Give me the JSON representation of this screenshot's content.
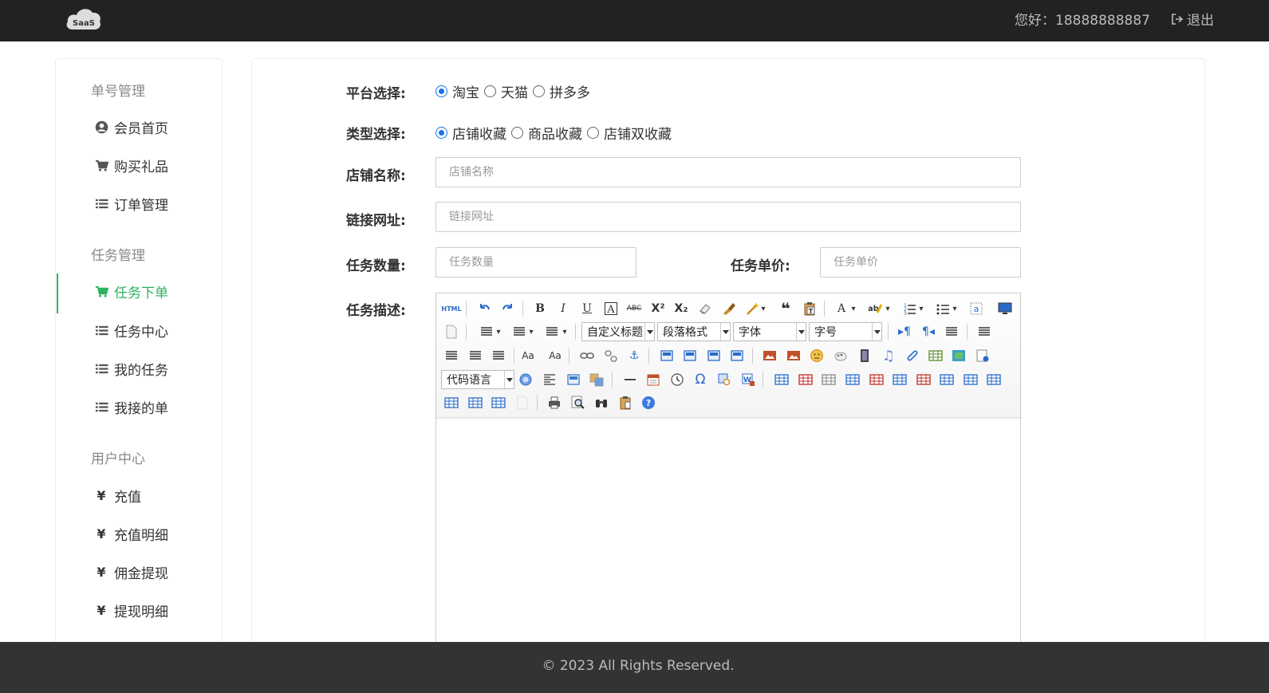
{
  "header": {
    "logo_text": "SaaS",
    "greeting": "您好：18888888887",
    "logout_label": "退出"
  },
  "sidebar": {
    "sections": [
      {
        "title": "单号管理",
        "items": [
          {
            "label": "会员首页",
            "icon": "user-circle-icon"
          },
          {
            "label": "购买礼品",
            "icon": "cart-icon"
          },
          {
            "label": "订单管理",
            "icon": "list-icon"
          }
        ]
      },
      {
        "title": "任务管理",
        "items": [
          {
            "label": "任务下单",
            "icon": "cart-icon",
            "active": true
          },
          {
            "label": "任务中心",
            "icon": "list-icon"
          },
          {
            "label": "我的任务",
            "icon": "list-icon"
          },
          {
            "label": "我接的单",
            "icon": "list-icon"
          }
        ]
      },
      {
        "title": "用户中心",
        "items": [
          {
            "label": "充值",
            "icon": "yen-icon"
          },
          {
            "label": "充值明细",
            "icon": "yen-icon"
          },
          {
            "label": "佣金提现",
            "icon": "yen-icon"
          },
          {
            "label": "提现明细",
            "icon": "yen-icon"
          }
        ]
      }
    ],
    "active_color": "#2db360",
    "yen_symbol": "¥"
  },
  "form": {
    "platform": {
      "label": "平台选择:",
      "options": [
        "淘宝",
        "天猫",
        "拼多多"
      ],
      "selected": "淘宝"
    },
    "type": {
      "label": "类型选择:",
      "options": [
        "店铺收藏",
        "商品收藏",
        "店铺双收藏"
      ],
      "selected": "店铺收藏"
    },
    "shop_name": {
      "label": "店铺名称:",
      "placeholder": "店铺名称",
      "value": ""
    },
    "link_url": {
      "label": "链接网址:",
      "placeholder": "链接网址",
      "value": ""
    },
    "task_count": {
      "label": "任务数量:",
      "placeholder": "任务数量",
      "value": ""
    },
    "task_price": {
      "label": "任务单价:",
      "placeholder": "任务单价",
      "value": ""
    },
    "description": {
      "label": "任务描述:"
    }
  },
  "editor": {
    "selects": {
      "custom_title": "自定义标题",
      "paragraph": "段落格式",
      "font_family": "字体",
      "font_size": "字号",
      "code_language": "代码语言"
    },
    "html_label": "HTML"
  },
  "footer": {
    "copyright": "© 2023 All Rights Reserved."
  }
}
